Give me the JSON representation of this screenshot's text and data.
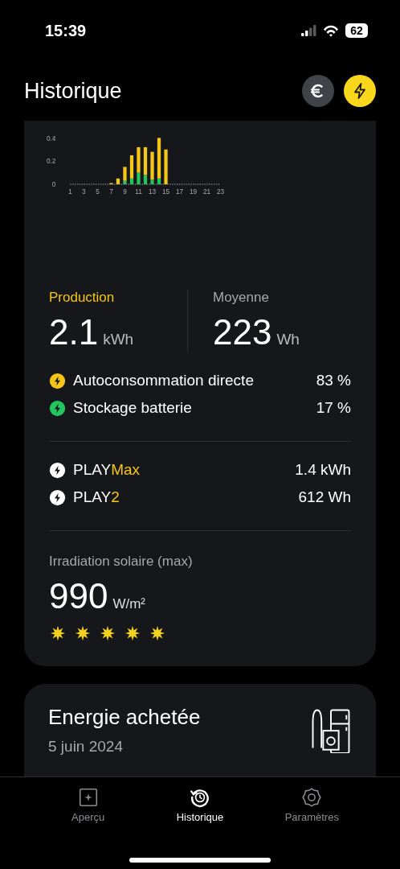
{
  "status_bar": {
    "time": "15:39",
    "battery": "62"
  },
  "header": {
    "title": "Historique",
    "toggles": [
      {
        "kind": "euro",
        "selected": false
      },
      {
        "kind": "energy",
        "selected": true
      }
    ]
  },
  "production_card": {
    "chart_data": {
      "type": "bar",
      "stacked": true,
      "x": [
        1,
        2,
        3,
        4,
        5,
        6,
        7,
        8,
        9,
        10,
        11,
        12,
        13,
        14,
        15,
        16,
        17,
        18,
        19,
        20,
        21,
        22,
        23
      ],
      "series": [
        {
          "color": "#22c55e",
          "values": [
            0,
            0,
            0,
            0,
            0,
            0,
            0,
            0,
            0.03,
            0.05,
            0.1,
            0.08,
            0.04,
            0.05,
            0,
            0,
            0,
            0,
            0,
            0,
            0,
            0,
            0
          ]
        },
        {
          "color": "#f5c518",
          "values": [
            0,
            0,
            0,
            0,
            0,
            0,
            0.01,
            0.05,
            0.12,
            0.2,
            0.22,
            0.24,
            0.24,
            0.35,
            0.3,
            0,
            0,
            0,
            0,
            0,
            0,
            0,
            0
          ]
        }
      ],
      "xlim": [
        1,
        23
      ],
      "ylim": [
        0,
        0.4
      ],
      "yticks": [
        0,
        0.2,
        0.4
      ],
      "xticks": [
        1,
        3,
        5,
        7,
        9,
        11,
        13,
        15,
        17,
        19,
        21,
        23
      ]
    },
    "stats": [
      {
        "kind": "production",
        "label": "Production",
        "value": "2.1",
        "unit": "kWh"
      },
      {
        "kind": "average",
        "label": "Moyenne",
        "value": "223",
        "unit": "Wh"
      }
    ],
    "breakdown": [
      {
        "label": "Autoconsommation directe",
        "value": "83 %",
        "color": "#f5c518"
      },
      {
        "label": "Stockage batterie",
        "value": "17 %",
        "color": "#22c55e"
      }
    ],
    "devices": [
      {
        "name": "PLAY",
        "suffix": "Max",
        "value": "1.4 kWh"
      },
      {
        "name": "PLAY",
        "suffix": "2",
        "value": "612 Wh"
      }
    ],
    "irradiation": {
      "label": "Irradiation solaire (max)",
      "value": "990",
      "unit": "W/m²",
      "stars": 5
    }
  },
  "purchase_card": {
    "title": "Energie achetée",
    "date": "5 juin 2024"
  },
  "tab_bar": [
    {
      "kind": "overview",
      "label": "Aperçu",
      "selected": false
    },
    {
      "kind": "history",
      "label": "Historique",
      "selected": true
    },
    {
      "kind": "settings",
      "label": "Paramètres",
      "selected": false
    }
  ]
}
